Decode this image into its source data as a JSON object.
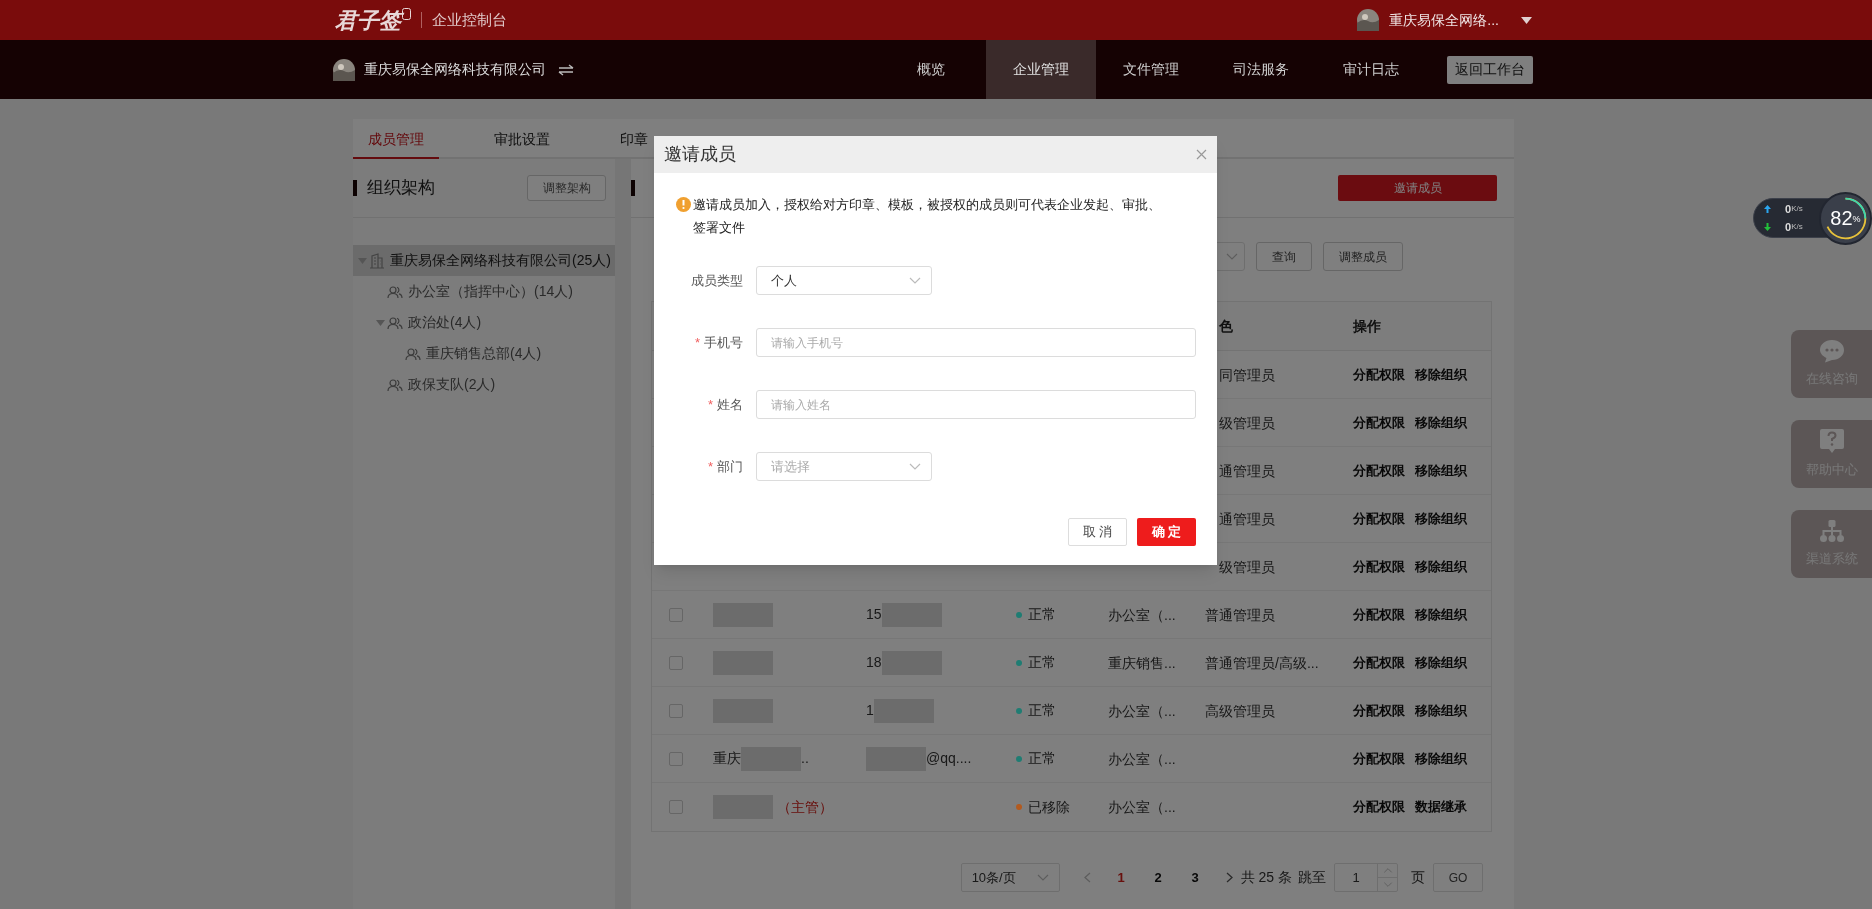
{
  "top_bar": {
    "logo": "君子签",
    "product": "企业控制台",
    "account": "重庆易保全网络..."
  },
  "nav_bar": {
    "company": "重庆易保全网络科技有限公司",
    "items": [
      {
        "label": "概览",
        "selected": false
      },
      {
        "label": "企业管理",
        "selected": true
      },
      {
        "label": "文件管理",
        "selected": false
      },
      {
        "label": "司法服务",
        "selected": false
      },
      {
        "label": "审计日志",
        "selected": false
      }
    ],
    "return_button": "返回工作台"
  },
  "tabs": [
    {
      "label": "成员管理",
      "selected": true
    },
    {
      "label": "审批设置",
      "selected": false
    },
    {
      "label": "印章",
      "selected": false
    }
  ],
  "org_panel": {
    "title": "组织架构",
    "button": "调整架构",
    "tree": [
      {
        "label": "重庆易保全网络科技有限公司(25人)",
        "kind": "company",
        "selected": true,
        "expanded": true,
        "children": [
          {
            "label": "办公室（指挥中心）(14人)",
            "kind": "group",
            "selected": false
          },
          {
            "label": "政治处(4人)",
            "kind": "group",
            "selected": false,
            "expanded": true,
            "children": [
              {
                "label": "重庆销售总部(4人)",
                "kind": "group",
                "selected": false
              }
            ]
          },
          {
            "label": "政保支队(2人)",
            "kind": "group",
            "selected": false
          }
        ]
      }
    ]
  },
  "member_panel": {
    "invite_button": "邀请成员",
    "query_button": "查询",
    "adjust_button": "调整成员",
    "columns": [
      {
        "label": "色"
      },
      {
        "label": "操作"
      }
    ],
    "rows": [
      {
        "kind": "covered",
        "role": "同管理员",
        "actions": [
          "分配权限",
          "移除组织"
        ]
      },
      {
        "kind": "covered",
        "role": "级管理员",
        "actions": [
          "分配权限",
          "移除组织"
        ]
      },
      {
        "kind": "covered",
        "role": "通管理员",
        "actions": [
          "分配权限",
          "移除组织"
        ]
      },
      {
        "kind": "covered",
        "role": "通管理员",
        "actions": [
          "分配权限",
          "移除组织"
        ]
      },
      {
        "kind": "covered",
        "role": "级管理员",
        "actions": [
          "分配权限",
          "移除组织"
        ]
      },
      {
        "kind": "full",
        "checked": false,
        "name": [
          {
            "kind": "redacted"
          }
        ],
        "phone": [
          {
            "kind": "text",
            "text": "15"
          },
          {
            "kind": "redacted"
          }
        ],
        "status": "正常",
        "color": "#1f7d73",
        "dept": "办公室（...",
        "role": "普通管理员",
        "actions": [
          "分配权限",
          "移除组织"
        ]
      },
      {
        "kind": "full",
        "checked": false,
        "name": [
          {
            "kind": "redacted"
          }
        ],
        "phone": [
          {
            "kind": "text",
            "text": "18"
          },
          {
            "kind": "redacted"
          }
        ],
        "status": "正常",
        "color": "#1f7d73",
        "dept": "重庆销售...",
        "role": "普通管理员/高级...",
        "actions": [
          "分配权限",
          "移除组织"
        ]
      },
      {
        "kind": "full",
        "checked": false,
        "name": [
          {
            "kind": "redacted"
          }
        ],
        "phone": [
          {
            "kind": "text",
            "text": "1"
          },
          {
            "kind": "redacted"
          }
        ],
        "status": "正常",
        "color": "#1f7d73",
        "dept": "办公室（...",
        "role": "高级管理员",
        "actions": [
          "分配权限",
          "移除组织"
        ]
      },
      {
        "kind": "full",
        "checked": false,
        "name": [
          {
            "kind": "text",
            "text": "重庆"
          },
          {
            "kind": "redacted"
          },
          {
            "kind": "text",
            "text": ".."
          }
        ],
        "phone": [
          {
            "kind": "redacted"
          },
          {
            "kind": "text",
            "text": "@qq...."
          }
        ],
        "status": "正常",
        "color": "#1f7d73",
        "dept": "办公室（...",
        "actions": [
          "分配权限",
          "移除组织"
        ]
      },
      {
        "kind": "full",
        "checked": false,
        "name": [
          {
            "kind": "redacted"
          },
          {
            "kind": "tag",
            "text": "（主管）"
          }
        ],
        "status": "已移除",
        "color": "#b35a1e",
        "dept": "办公室（...",
        "actions": [
          "分配权限",
          "数据继承"
        ]
      }
    ],
    "pagination": {
      "page_size": "10条/页",
      "pages": [
        {
          "label": "1",
          "selected": true
        },
        {
          "label": "2",
          "selected": false
        },
        {
          "label": "3",
          "selected": false
        }
      ],
      "total": "共 25 条",
      "jump_label": "跳至",
      "jump_value": "1",
      "page_unit": "页",
      "go": "GO"
    }
  },
  "side_tools": [
    {
      "kind": "chat",
      "label": "在线咨询"
    },
    {
      "kind": "help",
      "label": "帮助中心"
    },
    {
      "kind": "org",
      "label": "渠道系统"
    }
  ],
  "net_monitor": {
    "up": "0",
    "up_unit": "K/s",
    "down": "0",
    "down_unit": "K/s",
    "percent": "82",
    "percent_unit": "%"
  },
  "dialog": {
    "title": "邀请成员",
    "notice": "邀请成员加入，授权给对方印章、模板，被授权的成员则可代表企业发起、审批、签署文件",
    "fields": [
      {
        "kind": "select",
        "label": "成员类型",
        "value": "个人"
      },
      {
        "kind": "input",
        "required_mark": "*",
        "label": "手机号",
        "placeholder": "请输入手机号"
      },
      {
        "kind": "input",
        "required_mark": "*",
        "label": "姓名",
        "placeholder": "请输入姓名"
      },
      {
        "kind": "select",
        "required_mark": "*",
        "label": "部门",
        "placeholder": "请选择"
      }
    ],
    "cancel": "取 消",
    "confirm": "确 定"
  }
}
